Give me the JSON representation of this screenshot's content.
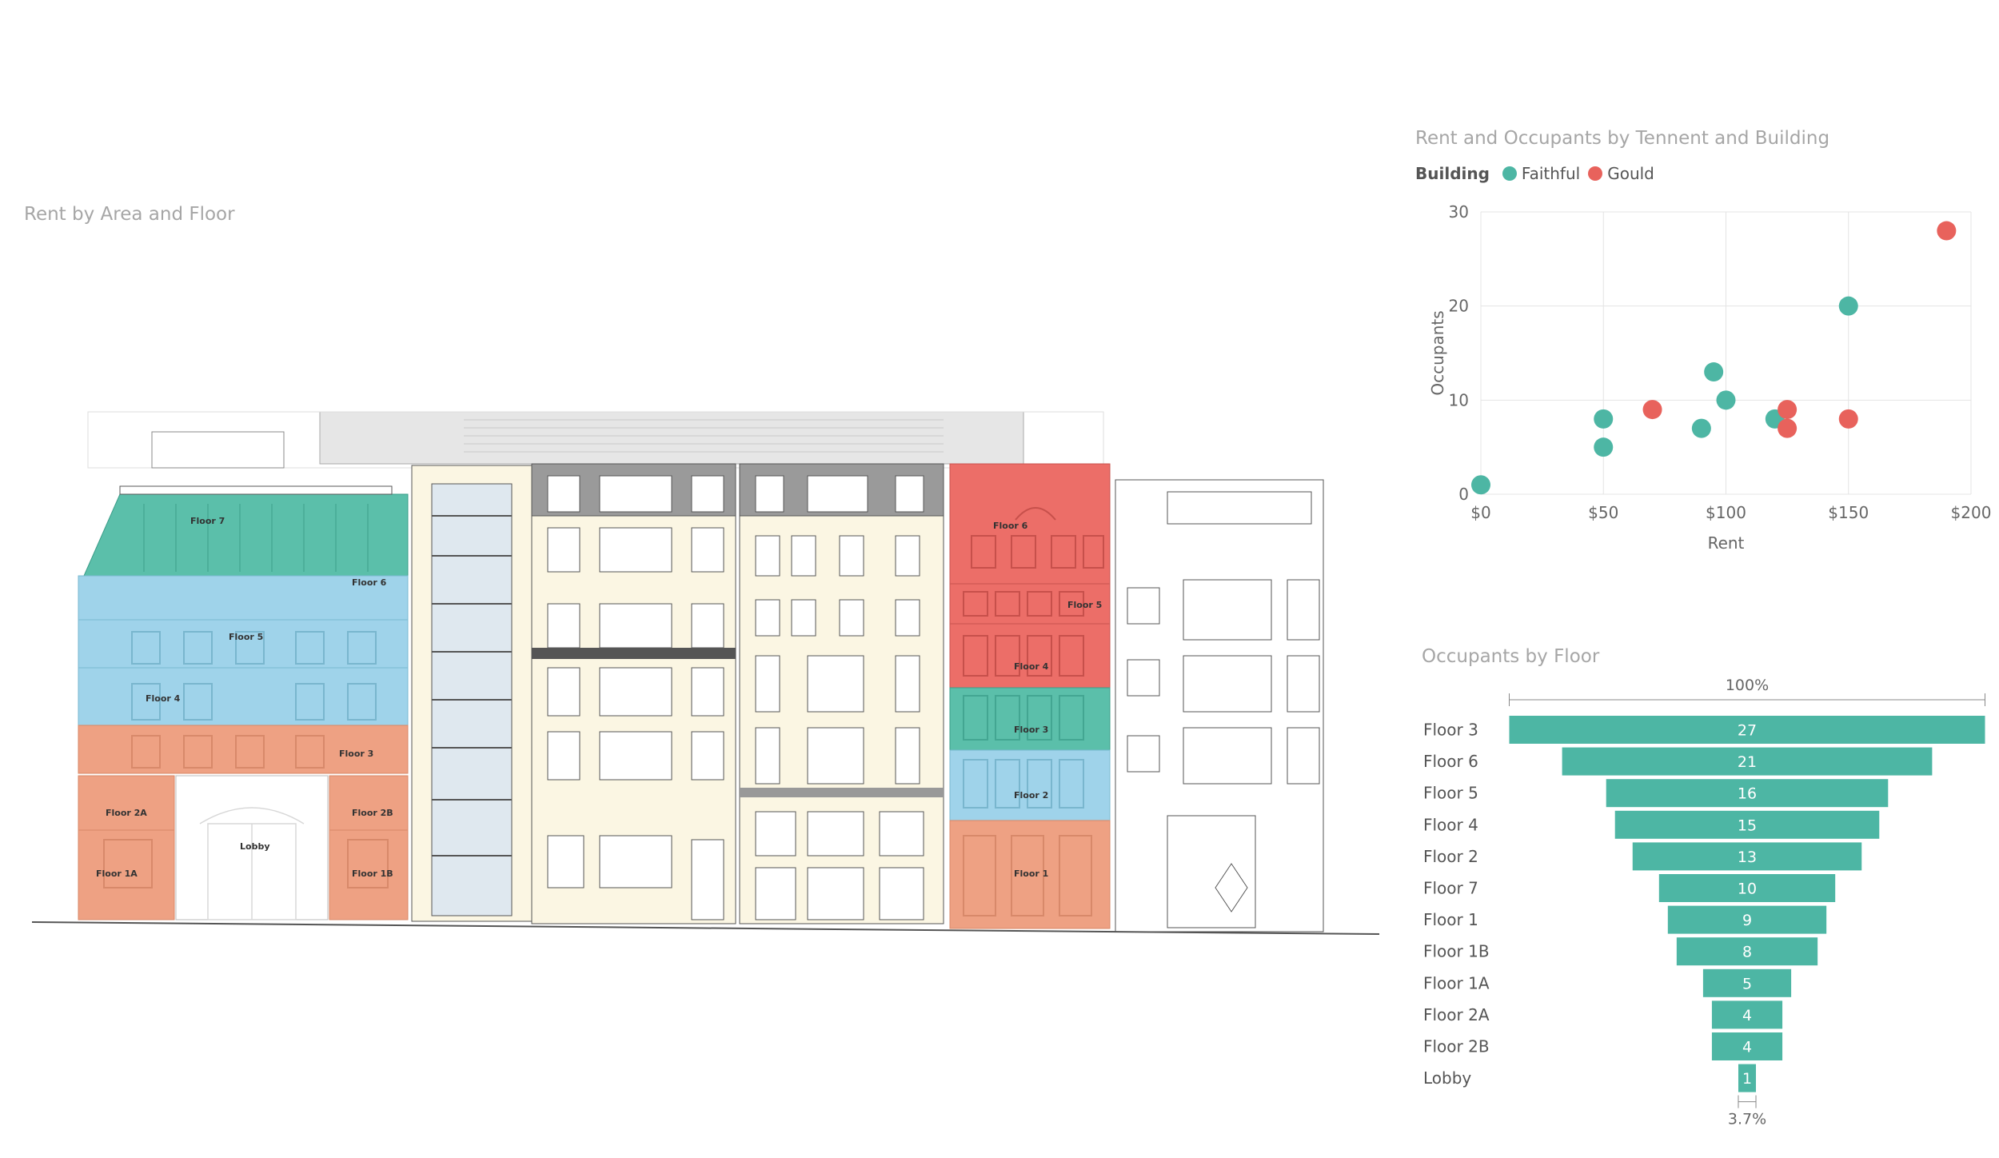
{
  "building_visual": {
    "title": "Rent by Area and Floor",
    "labels": {
      "floor7": "Floor 7",
      "floor6": "Floor 6",
      "floor5": "Floor 5",
      "floor4": "Floor 4",
      "floor3": "Floor 3",
      "floor2a": "Floor 2A",
      "floor2b": "Floor 2B",
      "lobby": "Lobby",
      "floor1a": "Floor 1A",
      "floor1b": "Floor 1B",
      "r_floor6": "Floor 6",
      "r_floor5": "Floor 5",
      "r_floor4": "Floor 4",
      "r_floor3": "Floor 3",
      "r_floor2": "Floor 2",
      "r_floor1": "Floor 1"
    },
    "colors": {
      "teal": "#5bbfaa",
      "blue": "#9fd3ea",
      "orange": "#eea183",
      "red": "#ec6e68"
    }
  },
  "scatter_visual": {
    "title": "Rent and Occupants by Tennent and Building",
    "legend_title": "Building",
    "chart_data": {
      "type": "scatter",
      "xlabel": "Rent",
      "ylabel": "Occupants",
      "xlim": [
        0,
        200
      ],
      "ylim": [
        0,
        30
      ],
      "x_ticks": [
        "$0",
        "$50",
        "$100",
        "$150",
        "$200"
      ],
      "y_ticks": [
        "0",
        "10",
        "20",
        "30"
      ],
      "grid": true,
      "legend_placement": "top-left",
      "series": [
        {
          "name": "Faithful",
          "color": "#4db6a4",
          "points": [
            [
              0,
              1
            ],
            [
              50,
              8
            ],
            [
              50,
              5
            ],
            [
              90,
              7
            ],
            [
              95,
              13
            ],
            [
              100,
              10
            ],
            [
              120,
              8
            ],
            [
              150,
              20
            ]
          ]
        },
        {
          "name": "Gould",
          "color": "#e8625c",
          "points": [
            [
              70,
              9
            ],
            [
              125,
              9
            ],
            [
              125,
              7
            ],
            [
              150,
              8
            ],
            [
              190,
              28
            ]
          ]
        }
      ]
    }
  },
  "funnel_visual": {
    "title": "Occupants by Floor",
    "top_pct": "100%",
    "bottom_pct": "3.7%",
    "chart_data": {
      "type": "bar",
      "subtype": "funnel",
      "color": "#4db6a4",
      "categories": [
        "Floor 3",
        "Floor 6",
        "Floor 5",
        "Floor 4",
        "Floor 2",
        "Floor 7",
        "Floor 1",
        "Floor 1B",
        "Floor 1A",
        "Floor 2A",
        "Floor 2B",
        "Lobby"
      ],
      "values": [
        27,
        21,
        16,
        15,
        13,
        10,
        9,
        8,
        5,
        4,
        4,
        1
      ]
    }
  }
}
